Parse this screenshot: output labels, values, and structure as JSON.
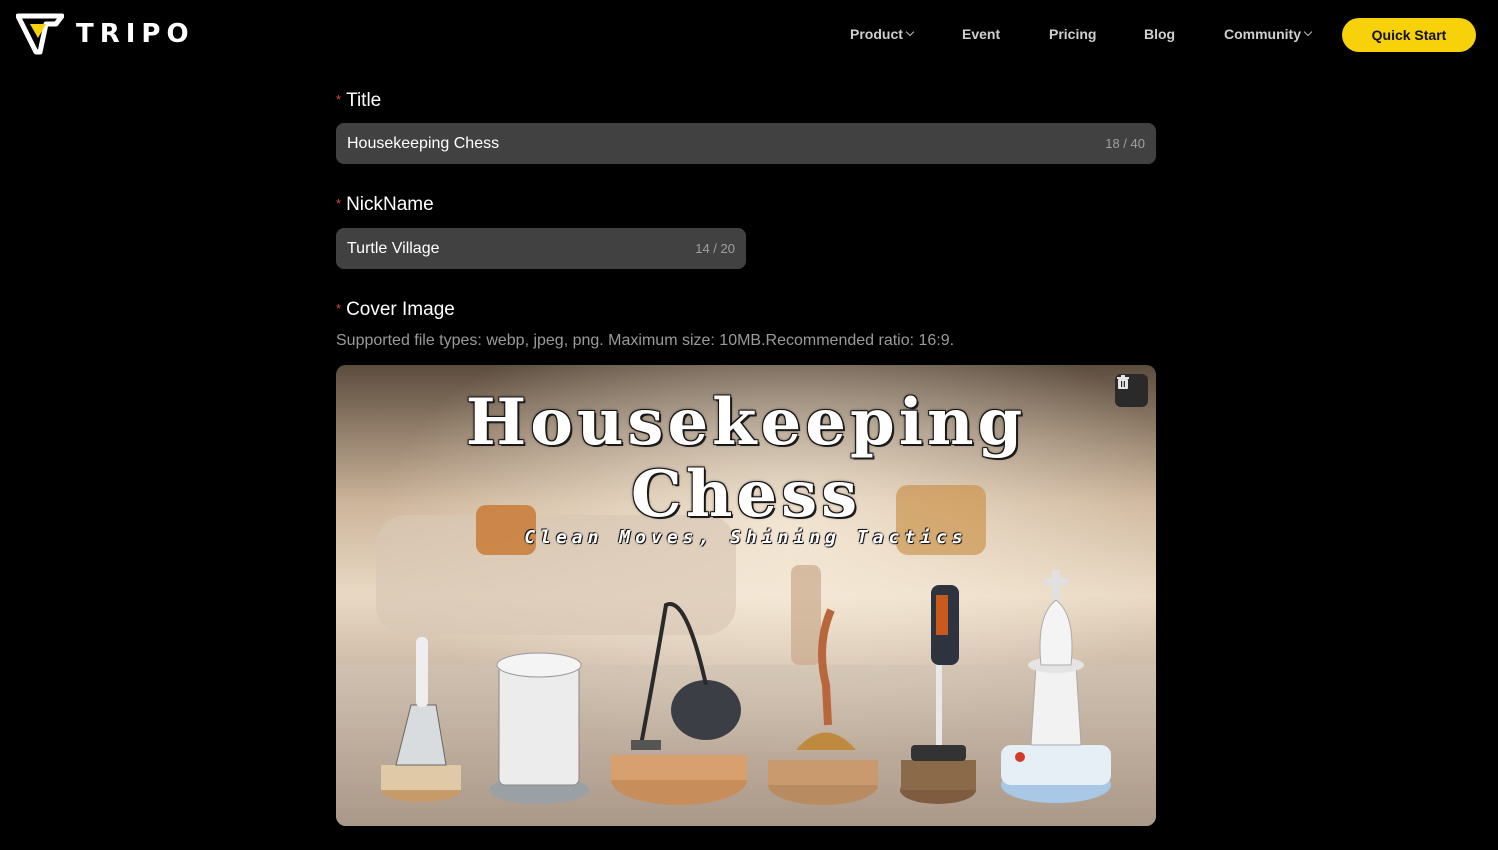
{
  "brand": {
    "name": "TRIPO",
    "accent": "#f7d10a"
  },
  "nav": {
    "items": [
      {
        "label": "Product",
        "dropdown": true
      },
      {
        "label": "Event",
        "dropdown": false
      },
      {
        "label": "Pricing",
        "dropdown": false
      },
      {
        "label": "Blog",
        "dropdown": false
      },
      {
        "label": "Community",
        "dropdown": true
      }
    ],
    "cta_label": "Quick Start"
  },
  "form": {
    "title": {
      "required_mark": "*",
      "label": "Title",
      "value": "Housekeeping Chess",
      "count": "18 / 40"
    },
    "nickname": {
      "required_mark": "*",
      "label": "NickName",
      "value": "Turtle Village",
      "count": "14 / 20"
    },
    "cover": {
      "required_mark": "*",
      "label": "Cover Image",
      "hint": "Supported file types: webp, jpeg, png. Maximum size: 10MB.Recommended ratio: 16:9.",
      "image_text": {
        "line1": "Housekeeping",
        "line2": "Chess",
        "subtitle": "Clean Moves, Shining Tactics"
      },
      "delete_icon": "trash-icon"
    }
  }
}
